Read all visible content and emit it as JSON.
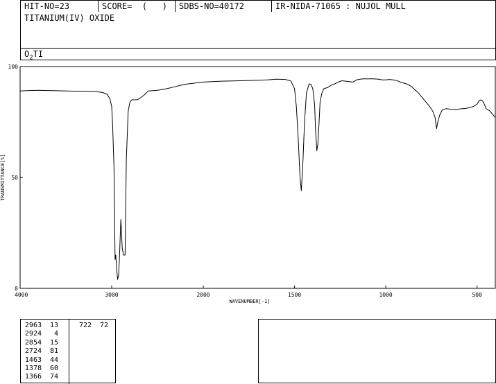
{
  "header": {
    "hit_no": "HIT-NO=23",
    "score": "SCORE=  (   )",
    "sdbs_no": "SDBS-NO=40172",
    "ir_nida": "IR-NIDA-71065 : NUJOL MULL",
    "compound_name": "TITANIUM(IV) OXIDE",
    "formula": "O2TI"
  },
  "chart_data": {
    "type": "line",
    "title": "",
    "xlabel": "WAVENUMBER[-1]",
    "ylabel": "TRANSMITTANCE[%]",
    "xlim": [
      4000,
      400
    ],
    "ylim": [
      0,
      100
    ],
    "x_ticks": [
      4000,
      3000,
      2000,
      1500,
      1000,
      500
    ],
    "y_ticks": [
      0,
      50,
      100
    ],
    "grid": false,
    "series": [
      {
        "x": [
          4000,
          3900,
          3800,
          3700,
          3600,
          3500,
          3400,
          3300,
          3200,
          3100,
          3050,
          3020,
          3000,
          2990,
          2975,
          2963,
          2955,
          2945,
          2935,
          2924,
          2915,
          2900,
          2895,
          2885,
          2870,
          2854,
          2840,
          2820,
          2800,
          2780,
          2760,
          2740,
          2724,
          2700,
          2650,
          2600,
          2500,
          2400,
          2300,
          2200,
          2100,
          2000,
          1900,
          1800,
          1700,
          1650,
          1600,
          1550,
          1520,
          1500,
          1490,
          1480,
          1470,
          1463,
          1455,
          1445,
          1435,
          1420,
          1410,
          1400,
          1390,
          1385,
          1378,
          1372,
          1366,
          1360,
          1350,
          1340,
          1320,
          1300,
          1280,
          1260,
          1240,
          1200,
          1180,
          1160,
          1140,
          1120,
          1100,
          1080,
          1060,
          1040,
          1020,
          1000,
          980,
          960,
          940,
          920,
          900,
          880,
          860,
          840,
          820,
          800,
          780,
          760,
          740,
          730,
          722,
          715,
          705,
          690,
          670,
          640,
          620,
          600,
          580,
          560,
          540,
          520,
          500,
          490,
          480,
          470,
          460,
          450,
          440,
          430,
          420,
          410,
          400
        ],
        "y": [
          89,
          89.2,
          89.3,
          89.2,
          89.1,
          89,
          88.9,
          88.9,
          88.8,
          88.3,
          87.5,
          85.5,
          82,
          74,
          55,
          13,
          15,
          8,
          4,
          6,
          14,
          31,
          27,
          18,
          15,
          15,
          58,
          80,
          84,
          85,
          85,
          85,
          85,
          85.5,
          87,
          89,
          89.3,
          90,
          91,
          92,
          92.5,
          93,
          93.4,
          93.6,
          93.8,
          94,
          94.3,
          94.2,
          93.5,
          90,
          82,
          68,
          50,
          44,
          55,
          75,
          88,
          92.2,
          92,
          90,
          83,
          72,
          62,
          65,
          74,
          84,
          88,
          90,
          90.5,
          91.5,
          92.2,
          93,
          93.6,
          93.2,
          93,
          94,
          94.3,
          94.5,
          94.4,
          94.5,
          94.4,
          94.3,
          94,
          94,
          94.2,
          94,
          93.7,
          93,
          92.5,
          92,
          91,
          89.5,
          88,
          86,
          84,
          82,
          79.5,
          77,
          72,
          75,
          78,
          80.5,
          81,
          80.7,
          80.6,
          80.8,
          81,
          81.2,
          81.5,
          82,
          83,
          84.5,
          85,
          84.5,
          83,
          81,
          80.5,
          80,
          79,
          78,
          77
        ]
      }
    ],
    "peaks": [
      {
        "x": 2963,
        "y": 13
      },
      {
        "x": 2924,
        "y": 4
      },
      {
        "x": 2854,
        "y": 15
      },
      {
        "x": 2724,
        "y": 81
      },
      {
        "x": 1463,
        "y": 44
      },
      {
        "x": 1378,
        "y": 60
      },
      {
        "x": 1366,
        "y": 74
      },
      {
        "x": 722,
        "y": 72
      }
    ]
  }
}
